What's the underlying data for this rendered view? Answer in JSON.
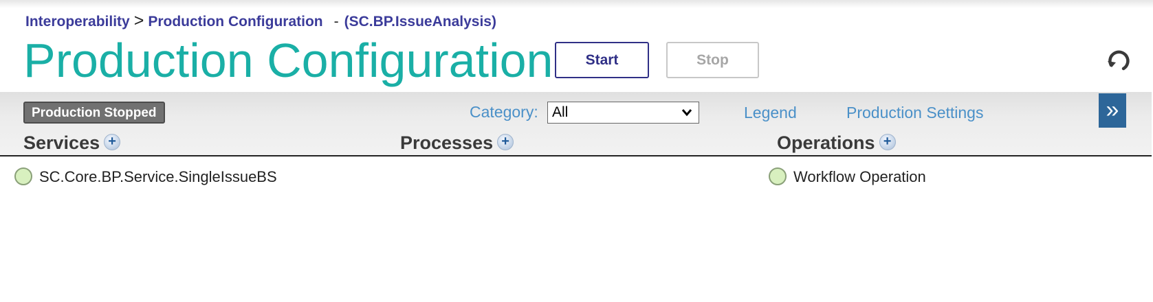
{
  "breadcrumb": {
    "root": "Interoperability",
    "separator": ">",
    "current": "Production Configuration",
    "dash": "-",
    "production": "(SC.BP.IssueAnalysis)"
  },
  "header": {
    "title": "Production Configuration",
    "start_label": "Start",
    "stop_label": "Stop"
  },
  "toolbar": {
    "status": "Production Stopped",
    "category_label": "Category:",
    "category_value": "All",
    "legend_label": "Legend",
    "settings_label": "Production Settings",
    "expand_label": "»"
  },
  "columns": {
    "services": {
      "title": "Services",
      "items": [
        "SC.Core.BP.Service.SingleIssueBS"
      ]
    },
    "processes": {
      "title": "Processes",
      "items": []
    },
    "operations": {
      "title": "Operations",
      "items": [
        "Workflow Operation"
      ]
    }
  },
  "colors": {
    "title": "#1aafa6",
    "breadcrumb": "#3b3b9a",
    "link": "#4a90c8",
    "status_badge": "#717171",
    "expand_button": "#2d6699",
    "item_dot": "#d8f0bf"
  },
  "icons": {
    "refresh": "refresh-icon",
    "add": "plus-icon",
    "status": "status-dot-icon",
    "dropdown": "chevron-down-icon"
  }
}
